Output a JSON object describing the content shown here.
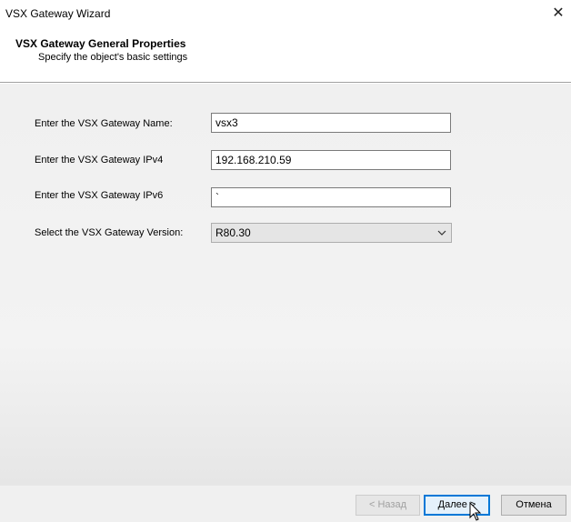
{
  "window": {
    "title": "VSX Gateway Wizard",
    "close_glyph": "✕"
  },
  "header": {
    "title": "VSX Gateway General Properties",
    "subtitle": "Specify the object's basic settings"
  },
  "form": {
    "name_label": "Enter the VSX Gateway Name:",
    "name_value": "vsx3",
    "ipv4_label": "Enter the VSX Gateway IPv4",
    "ipv4_value": "192.168.210.59",
    "ipv6_label": "Enter the VSX Gateway IPv6",
    "ipv6_value": "`",
    "version_label": "Select the VSX Gateway Version:",
    "version_value": "R80.30"
  },
  "buttons": {
    "back_label": "< Назад",
    "next_label": "Далее >",
    "cancel_label": "Отмена"
  }
}
